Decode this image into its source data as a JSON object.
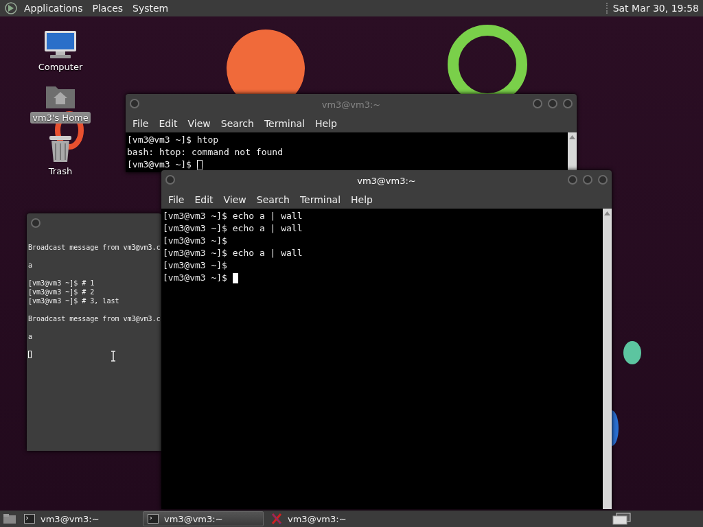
{
  "top_panel": {
    "menus": [
      "Applications",
      "Places",
      "System"
    ],
    "clock": "Sat Mar 30, 19:58"
  },
  "desktop_icons": [
    {
      "label": "Computer",
      "kind": "computer",
      "selected": false
    },
    {
      "label": "vm3's Home",
      "kind": "folder",
      "selected": true
    },
    {
      "label": "Trash",
      "kind": "trash",
      "selected": false
    }
  ],
  "windows": [
    {
      "kind": "terminal",
      "title": "vm3@vm3:~",
      "focused": false,
      "menu": [
        "File",
        "Edit",
        "View",
        "Search",
        "Terminal",
        "Help"
      ],
      "blocks": [
        [
          "[vm3@vm3 ~]$ htop",
          "bash: htop: command not found",
          "[vm3@vm3 ~]$"
        ]
      ]
    },
    {
      "kind": "console",
      "focused": false,
      "blocks": [
        [
          "Broadcast message from vm3@vm3.c"
        ],
        [
          "a"
        ],
        [
          "[vm3@vm3 ~]$ # 1",
          "[vm3@vm3 ~]$ # 2",
          "[vm3@vm3 ~]$ # 3, last"
        ],
        [
          "Broadcast message from vm3@vm3.c"
        ],
        [
          "a"
        ]
      ]
    },
    {
      "kind": "terminal",
      "title": "vm3@vm3:~",
      "focused": true,
      "menu": [
        "File",
        "Edit",
        "View",
        "Search",
        "Terminal",
        "Help"
      ],
      "blocks": [
        [
          "[vm3@vm3 ~]$ echo a | wall",
          "[vm3@vm3 ~]$ echo a | wall",
          "[vm3@vm3 ~]$",
          "[vm3@vm3 ~]$ echo a | wall",
          "[vm3@vm3 ~]$",
          "[vm3@vm3 ~]$"
        ]
      ]
    }
  ],
  "taskbar": [
    {
      "label": "vm3@vm3:~",
      "kind": "terminal",
      "selected": false
    },
    {
      "label": "vm3@vm3:~",
      "kind": "terminal",
      "selected": true
    },
    {
      "label": "vm3@vm3:~",
      "kind": "x",
      "selected": false
    }
  ]
}
